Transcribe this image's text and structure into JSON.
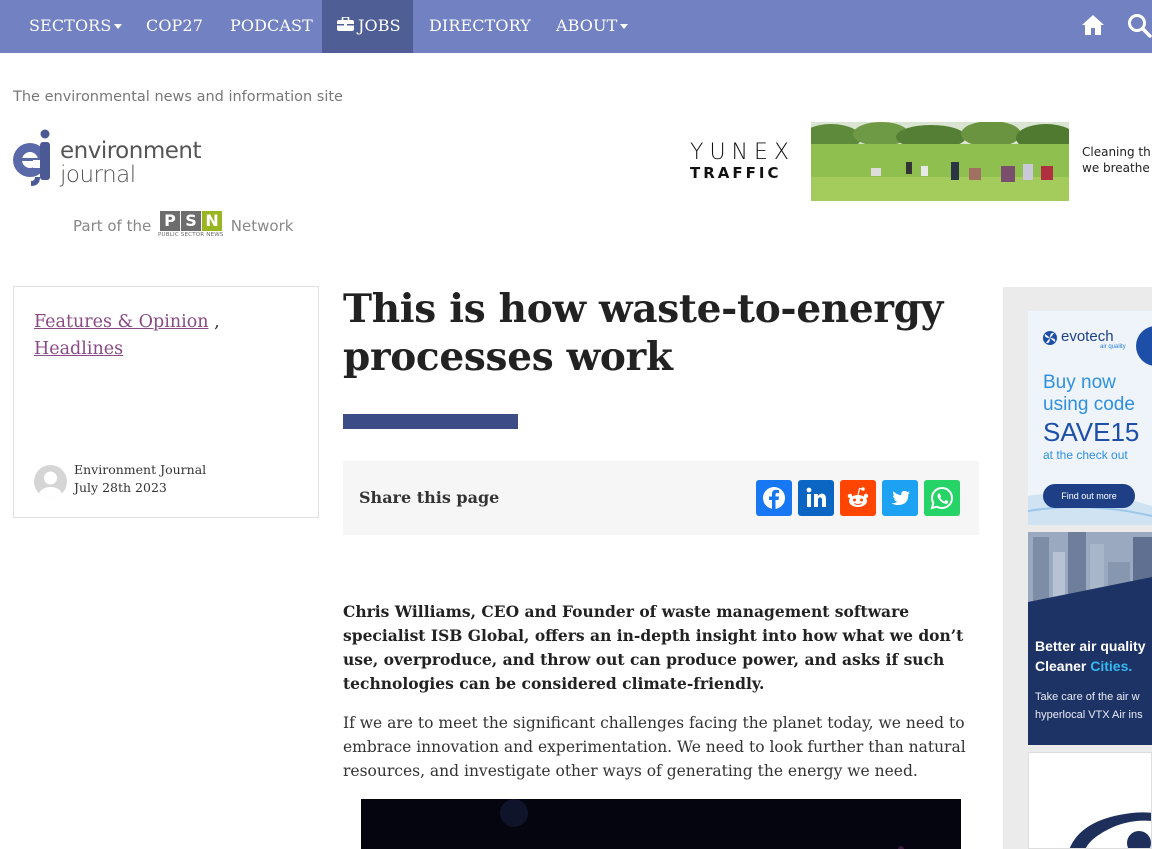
{
  "nav": {
    "items": [
      {
        "label": "SECTORS",
        "dropdown": true
      },
      {
        "label": "COP27",
        "dropdown": false
      },
      {
        "label": "PODCAST",
        "dropdown": false
      },
      {
        "label": "JOBS",
        "dropdown": false,
        "active": true,
        "icon": "briefcase-icon"
      },
      {
        "label": "DIRECTORY",
        "dropdown": false
      },
      {
        "label": "ABOUT",
        "dropdown": true
      }
    ],
    "home_icon": "home-icon",
    "search_icon": "search-icon",
    "color": "#7181c1",
    "active_color": "#4f5f96"
  },
  "header": {
    "tagline": "The environmental news and information site",
    "logo_mark": "ej",
    "logo_line1": "environment",
    "logo_line2": "journal",
    "psn_prefix": "Part of the",
    "psn_letters": [
      "P",
      "S",
      "N"
    ],
    "psn_sub": "PUBLIC SECTOR NEWS",
    "psn_suffix": "Network"
  },
  "banner_ad": {
    "brand_line1": "YUNEX",
    "brand_line2": "TRAFFIC",
    "text_line1": "Cleaning th",
    "text_line2": "we breathe"
  },
  "meta": {
    "category1": "Features & Opinion",
    "separator": ",",
    "category2": "Headlines",
    "author": "Environment Journal",
    "date": "July 28th 2023"
  },
  "article": {
    "title": "This is how waste-to-energy processes work",
    "accent_color": "#3b4c86",
    "share_label": "Share this page",
    "share_buttons": [
      {
        "name": "facebook",
        "color": "#1877f2"
      },
      {
        "name": "linkedin",
        "color": "#0a66c2"
      },
      {
        "name": "reddit",
        "color": "#ff4500"
      },
      {
        "name": "twitter",
        "color": "#1da1f2"
      },
      {
        "name": "whatsapp",
        "color": "#25d366"
      }
    ],
    "lead": "Chris Williams, CEO and Founder of waste management software specialist ISB Global, offers an in-depth insight into how what we don’t use, overproduce, and throw out can produce power, and asks if such technologies can be considered climate-friendly.",
    "paragraph1": "If we are to meet the significant challenges facing the planet today, we need to embrace innovation and experimentation. We need to look further than natural resources, and investigate other ways of generating the energy we need."
  },
  "sidebar_ads": {
    "ad1": {
      "brand": "evotech",
      "brand_sub": "air quality",
      "line1": "Buy now",
      "line2": "using code",
      "code": "SAVE15",
      "line3": "at the check out",
      "button": "Find out more"
    },
    "ad2": {
      "headline1": "Better air quality",
      "headline2a": "Cleaner",
      "headline2b": "Cities.",
      "body1": "Take care of the air w",
      "body2": "hyperlocal VTX Air ins"
    }
  }
}
